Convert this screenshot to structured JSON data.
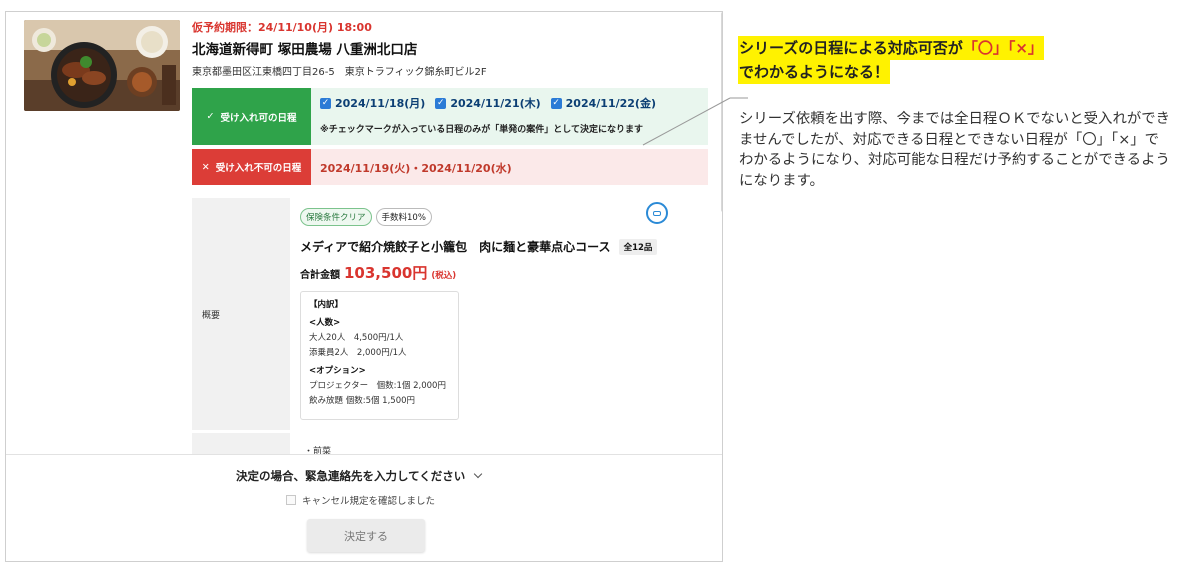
{
  "booking": {
    "deadline": "仮予約期限：24/11/10(月) 18:00",
    "store_name": "北海道新得町 塚田農場 八重洲北口店",
    "address": "東京都墨田区江東橋四丁目26-5　東京トラフィック錦糸町ビル2F"
  },
  "acceptable": {
    "label": "受け入れ可の日程",
    "dates": [
      "2024/11/18(月)",
      "2024/11/21(木)",
      "2024/11/22(金)"
    ],
    "note": "※チェックマークが入っている日程のみが「単発の案件」として決定になります"
  },
  "unacceptable": {
    "label": "受け入れ不可の日程",
    "dates": "2024/11/19(火)・2024/11/20(水)"
  },
  "summary": {
    "label": "概要",
    "badges": [
      "保険条件クリア",
      "手数料10%"
    ],
    "course": "メディアで紹介焼餃子と小籠包　肉に麺と豪華点心コース",
    "items_tag": "全12品",
    "total_label": "合計金額",
    "total_amount": "103,500円",
    "total_tax": "(税込)",
    "breakdown": {
      "title": "【内訳】",
      "people_head": "<人数>",
      "people": [
        "大人20人　4,500円/1人",
        "添乗員2人　2,000円/1人"
      ],
      "options_head": "<オプション>",
      "options": [
        "プロジェクター　個数:1個  2,000円",
        "飲み放題  個数:5個  1,500円"
      ]
    },
    "next_bullet": "・前菜"
  },
  "footer": {
    "emergency": "決定の場合、緊急連絡先を入力してください",
    "cancel_policy": "キャンセル規定を確認しました",
    "decide_button": "決定する"
  },
  "callout": {
    "headline_1a": "シリーズの日程による対応可否が",
    "headline_1b": "「〇」「×」",
    "headline_2": "でわかるようになる！",
    "description": "シリーズ依頼を出す際、今までは全日程ＯＫでないと受入れができませんでしたが、対応できる日程とできない日程が「〇」「×」でわかるようになり、対応可能な日程だけ予約することができるようになります。"
  },
  "colors": {
    "accept_green": "#2fa34a",
    "reject_red": "#dc3d37",
    "price_red": "#d9352f",
    "highlight_yellow": "#fff200"
  }
}
